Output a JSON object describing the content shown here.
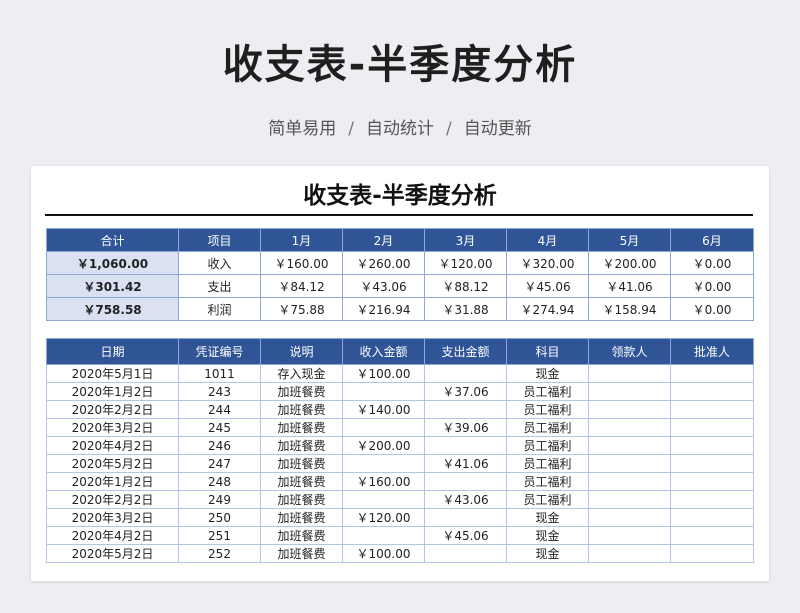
{
  "header": {
    "title": "收支表-半季度分析",
    "tagline": [
      "简单易用",
      "自动统计",
      "自动更新"
    ],
    "separator": "/"
  },
  "sheet": {
    "title": "收支表-半季度分析",
    "summary": {
      "headers": [
        "合计",
        "项目",
        "1月",
        "2月",
        "3月",
        "4月",
        "5月",
        "6月"
      ],
      "rows": [
        [
          "￥1,060.00",
          "收入",
          "￥160.00",
          "￥260.00",
          "￥120.00",
          "￥320.00",
          "￥200.00",
          "￥0.00"
        ],
        [
          "￥301.42",
          "支出",
          "￥84.12",
          "￥43.06",
          "￥88.12",
          "￥45.06",
          "￥41.06",
          "￥0.00"
        ],
        [
          "￥758.58",
          "利润",
          "￥75.88",
          "￥216.94",
          "￥31.88",
          "￥274.94",
          "￥158.94",
          "￥0.00"
        ]
      ]
    },
    "ledger": {
      "headers": [
        "日期",
        "凭证编号",
        "说明",
        "收入金额",
        "支出金额",
        "科目",
        "领款人",
        "批准人"
      ],
      "rows": [
        [
          "2020年5月1日",
          "1011",
          "存入现金",
          "￥100.00",
          "",
          "现金",
          "",
          ""
        ],
        [
          "2020年1月2日",
          "243",
          "加班餐费",
          "",
          "￥37.06",
          "员工福利",
          "",
          ""
        ],
        [
          "2020年2月2日",
          "244",
          "加班餐费",
          "￥140.00",
          "",
          "员工福利",
          "",
          ""
        ],
        [
          "2020年3月2日",
          "245",
          "加班餐费",
          "",
          "￥39.06",
          "员工福利",
          "",
          ""
        ],
        [
          "2020年4月2日",
          "246",
          "加班餐费",
          "￥200.00",
          "",
          "员工福利",
          "",
          ""
        ],
        [
          "2020年5月2日",
          "247",
          "加班餐费",
          "",
          "￥41.06",
          "员工福利",
          "",
          ""
        ],
        [
          "2020年1月2日",
          "248",
          "加班餐费",
          "￥160.00",
          "",
          "员工福利",
          "",
          ""
        ],
        [
          "2020年2月2日",
          "249",
          "加班餐费",
          "",
          "￥43.06",
          "员工福利",
          "",
          ""
        ],
        [
          "2020年3月2日",
          "250",
          "加班餐费",
          "￥120.00",
          "",
          "现金",
          "",
          ""
        ],
        [
          "2020年4月2日",
          "251",
          "加班餐费",
          "",
          "￥45.06",
          "现金",
          "",
          ""
        ],
        [
          "2020年5月2日",
          "252",
          "加班餐费",
          "￥100.00",
          "",
          "现金",
          "",
          ""
        ]
      ]
    }
  },
  "colors": {
    "header_blue": "#2f5597",
    "total_cell": "#d9e1f2",
    "grid_line": "#8ea9d6",
    "background": "#eceef1"
  }
}
